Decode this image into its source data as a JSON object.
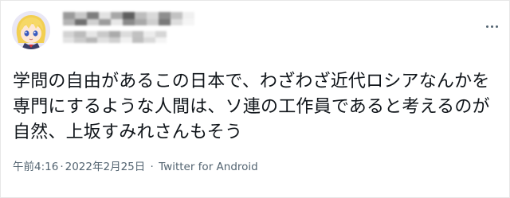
{
  "tweet": {
    "text": "学問の自由があるこの日本で、わざわざ近代ロシアなんかを専門にするような人間は、ソ連の工作員であると考えるのが自然、上坂すみれさんもそう",
    "time": "午前4:16",
    "separator": "·",
    "date": "2022年2月25日",
    "source": "Twitter for Android"
  },
  "author": {
    "avatar_icon": "anime-character-avatar-icon",
    "name_state": "pixelated",
    "handle_state": "pixelated"
  },
  "menu": {
    "icon": "more-options-icon"
  },
  "colors": {
    "text": "#0f1419",
    "secondary": "#536471",
    "border": "#e7e7e7",
    "background": "#ffffff"
  }
}
